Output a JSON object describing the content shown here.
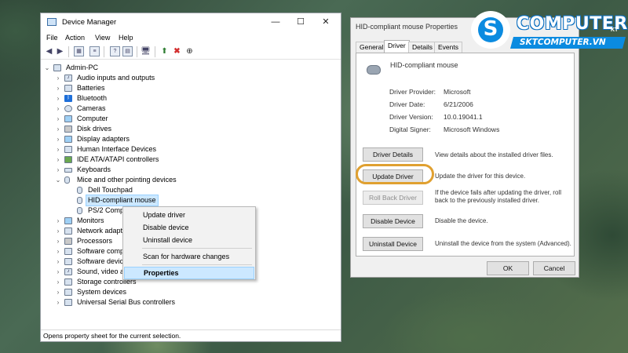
{
  "device_manager": {
    "title": "Device Manager",
    "controls": {
      "minimize": "—",
      "maximize": "☐",
      "close": "✕"
    },
    "menu": [
      "File",
      "Action",
      "View",
      "Help"
    ],
    "tree": {
      "root": "Admin-PC",
      "categories": [
        "Audio inputs and outputs",
        "Batteries",
        "Bluetooth",
        "Cameras",
        "Computer",
        "Disk drives",
        "Display adapters",
        "Human Interface Devices",
        "IDE ATA/ATAPI controllers",
        "Keyboards",
        "Mice and other pointing devices"
      ],
      "mice_children": [
        "Dell Touchpad",
        "HID-compliant mouse",
        "PS/2 Comp"
      ],
      "after": [
        "Monitors",
        "Network adapt",
        "Processors",
        "Software comp",
        "Software devic",
        "Sound, video a",
        "Storage controllers",
        "System devices",
        "Universal Serial Bus controllers"
      ]
    },
    "status": "Opens property sheet for the current selection."
  },
  "context_menu": {
    "items": [
      "Update driver",
      "Disable device",
      "Uninstall device",
      "Scan for hardware changes",
      "Properties"
    ]
  },
  "properties": {
    "title": "HID-compliant mouse Properties",
    "tabs": [
      "General",
      "Driver",
      "Details",
      "Events"
    ],
    "active_tab": "Driver",
    "device_name": "HID-compliant mouse",
    "fields": [
      {
        "label": "Driver Provider:",
        "value": "Microsoft"
      },
      {
        "label": "Driver Date:",
        "value": "6/21/2006"
      },
      {
        "label": "Driver Version:",
        "value": "10.0.19041.1"
      },
      {
        "label": "Digital Signer:",
        "value": "Microsoft Windows"
      }
    ],
    "actions": [
      {
        "label": "Driver Details",
        "desc": "View details about the installed driver files."
      },
      {
        "label": "Update Driver",
        "desc": "Update the driver for this device."
      },
      {
        "label": "Roll Back Driver",
        "desc": "If the device fails after updating the driver, roll back to the previously installed driver."
      },
      {
        "label": "Disable Device",
        "desc": "Disable the device."
      },
      {
        "label": "Uninstall Device",
        "desc": "Uninstall the device from the system (Advanced)."
      }
    ],
    "ok": "OK",
    "cancel": "Cancel"
  },
  "logo": {
    "word": "COMPUTER",
    "sub": "SKTCOMPUTER.VN",
    "tag": "KT"
  },
  "colors": {
    "accent": "#0b8be0",
    "highlight_ring": "#e0a030",
    "selection": "#cce8ff"
  }
}
